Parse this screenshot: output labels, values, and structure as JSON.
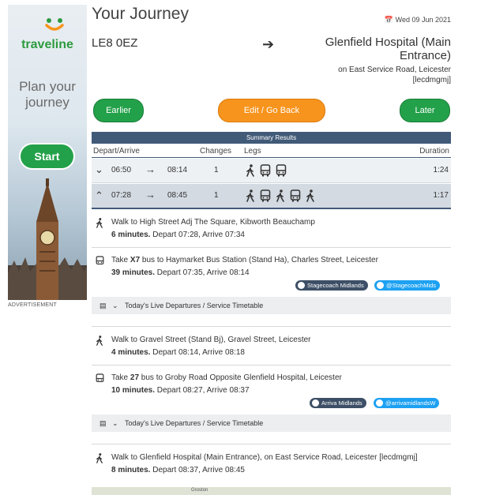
{
  "ad": {
    "brand": "traveline",
    "tagline": "Plan your journey",
    "start_label": "Start",
    "label": "ADVERTISEMENT"
  },
  "header": {
    "title": "Your Journey",
    "date": "Wed 09 Jun 2021",
    "calendar_icon": "calendar-icon"
  },
  "journey": {
    "from": "LE8 0EZ",
    "to": "Glenfield Hospital (Main Entrance)",
    "to_addr1": "on East Service Road, Leicester",
    "to_addr2": "[lecdmgmj]"
  },
  "buttons": {
    "earlier": "Earlier",
    "edit": "Edit / Go Back",
    "later": "Later"
  },
  "summary": {
    "heading": "Summary Results",
    "columns": {
      "depart_arrive": "Depart/Arrive",
      "changes": "Changes",
      "legs": "Legs",
      "duration": "Duration"
    },
    "rows": [
      {
        "depart": "06:50",
        "arrive": "08:14",
        "changes": "1",
        "duration": "1:24",
        "legs": [
          "walk-icon",
          "bus-icon",
          "bus-icon"
        ]
      },
      {
        "depart": "07:28",
        "arrive": "08:45",
        "changes": "1",
        "duration": "1:17",
        "legs": [
          "walk-icon",
          "bus-icon",
          "walk-icon",
          "bus-icon",
          "walk-icon"
        ]
      }
    ]
  },
  "steps": [
    {
      "line1": "Walk to High Street Adj The Square, Kibworth Beauchamp",
      "duration": "6 minutes.",
      "times": " Depart 07:28, Arrive 07:34"
    },
    {
      "line1_pre": "Take ",
      "route": "X7",
      "line1_post": " bus to Haymarket Bus Station (Stand Ha), Charles Street, Leicester",
      "duration": "39 minutes.",
      "times": " Depart 07:35, Arrive 08:14",
      "operator": "Stagecoach Midlands",
      "twitter": "@StagecoachMids"
    },
    {
      "line1": "Walk to Gravel Street (Stand Bj), Gravel Street, Leicester",
      "duration": "4 minutes.",
      "times": " Depart 08:14, Arrive 08:18"
    },
    {
      "line1_pre": "Take ",
      "route": "27",
      "line1_post": " bus to Groby Road Opposite Glenfield Hospital, Leicester",
      "duration": "10 minutes.",
      "times": " Depart 08:27, Arrive 08:37",
      "operator": "Arriva Midlands",
      "twitter": "@arrivamidlandsW"
    },
    {
      "line1": "Walk to Glenfield Hospital (Main Entrance), on East Service Road, Leicester [lecdmgmj]",
      "duration": "8 minutes.",
      "times": " Depart 08:37, Arrive 08:45"
    }
  ],
  "live_departures": "Today's Live Departures / Service Timetable",
  "map": {
    "place": "Groston"
  },
  "colors": {
    "green": "#23a14a",
    "orange": "#f7941d",
    "navy": "#415a78",
    "twitter": "#1da1f2"
  }
}
